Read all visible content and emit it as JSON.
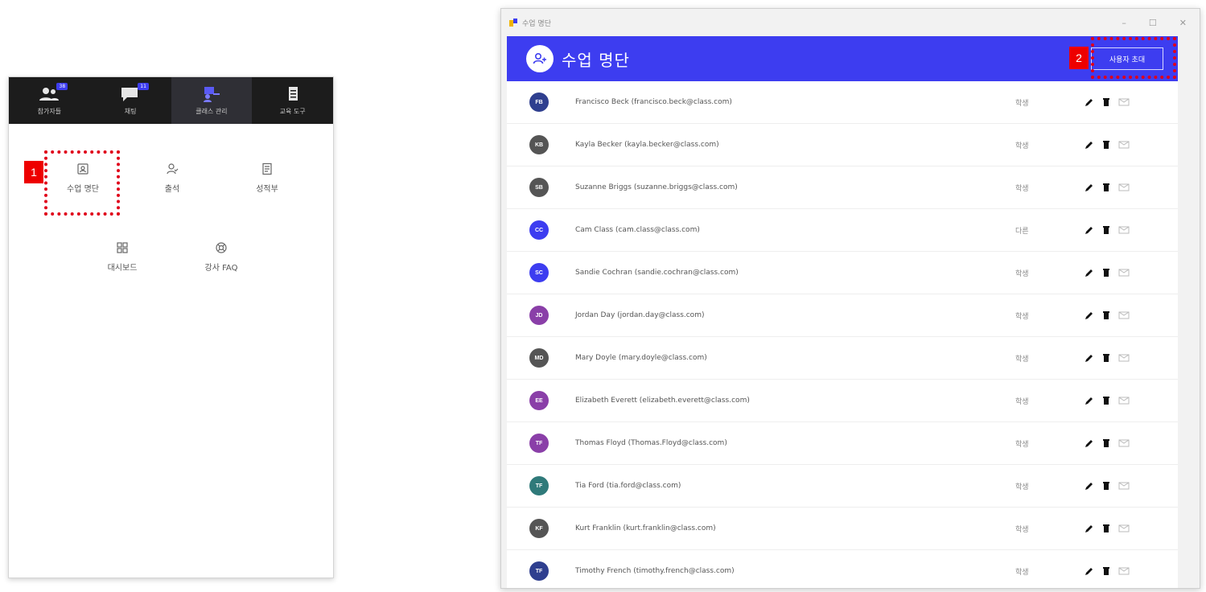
{
  "left_panel": {
    "toolbar": [
      {
        "label": "참가자들",
        "badge": "38",
        "icon": "people-icon",
        "active": false
      },
      {
        "label": "채팅",
        "badge": "11",
        "icon": "chat-icon",
        "active": false
      },
      {
        "label": "클래스 관리",
        "badge": "",
        "icon": "class-manage-icon",
        "active": true
      },
      {
        "label": "교육 도구",
        "badge": "",
        "icon": "clipboard-icon",
        "active": false
      }
    ],
    "menu": [
      {
        "label": "수업 명단",
        "icon": "roster-icon"
      },
      {
        "label": "출석",
        "icon": "attendance-icon"
      },
      {
        "label": "성적부",
        "icon": "gradebook-icon"
      },
      {
        "label": "대시보드",
        "icon": "dashboard-icon"
      },
      {
        "label": "강사 FAQ",
        "icon": "faq-icon"
      }
    ],
    "step_number": "1"
  },
  "window": {
    "title": "수업 명단",
    "controls": [
      "–",
      "☐",
      "✕"
    ],
    "header_title": "수업 명단",
    "invite_button": "사용자 초대",
    "step_number": "2",
    "accent_color": "#3d3df0",
    "rows": [
      {
        "initials": "FB",
        "color": "#2f3f8f",
        "name": "Francisco Beck (francisco.beck@class.com)",
        "role": "학생"
      },
      {
        "initials": "KB",
        "color": "#555555",
        "name": "Kayla Becker (kayla.becker@class.com)",
        "role": "학생"
      },
      {
        "initials": "SB",
        "color": "#555555",
        "name": "Suzanne Briggs (suzanne.briggs@class.com)",
        "role": "학생"
      },
      {
        "initials": "CC",
        "color": "#3d3df0",
        "name": "Cam Class (cam.class@class.com)",
        "role": "다른"
      },
      {
        "initials": "SC",
        "color": "#3d3df0",
        "name": "Sandie Cochran (sandie.cochran@class.com)",
        "role": "학생"
      },
      {
        "initials": "JD",
        "color": "#8a3fa8",
        "name": "Jordan Day (jordan.day@class.com)",
        "role": "학생"
      },
      {
        "initials": "MD",
        "color": "#555555",
        "name": "Mary Doyle (mary.doyle@class.com)",
        "role": "학생"
      },
      {
        "initials": "EE",
        "color": "#8a3fa8",
        "name": "Elizabeth Everett (elizabeth.everett@class.com)",
        "role": "학생"
      },
      {
        "initials": "TF",
        "color": "#8a3fa8",
        "name": "Thomas Floyd (Thomas.Floyd@class.com)",
        "role": "학생"
      },
      {
        "initials": "TF",
        "color": "#2f7a7a",
        "name": "Tia Ford (tia.ford@class.com)",
        "role": "학생"
      },
      {
        "initials": "KF",
        "color": "#555555",
        "name": "Kurt Franklin (kurt.franklin@class.com)",
        "role": "학생"
      },
      {
        "initials": "TF",
        "color": "#2f3f8f",
        "name": "Timothy French (timothy.french@class.com)",
        "role": "학생"
      }
    ]
  }
}
